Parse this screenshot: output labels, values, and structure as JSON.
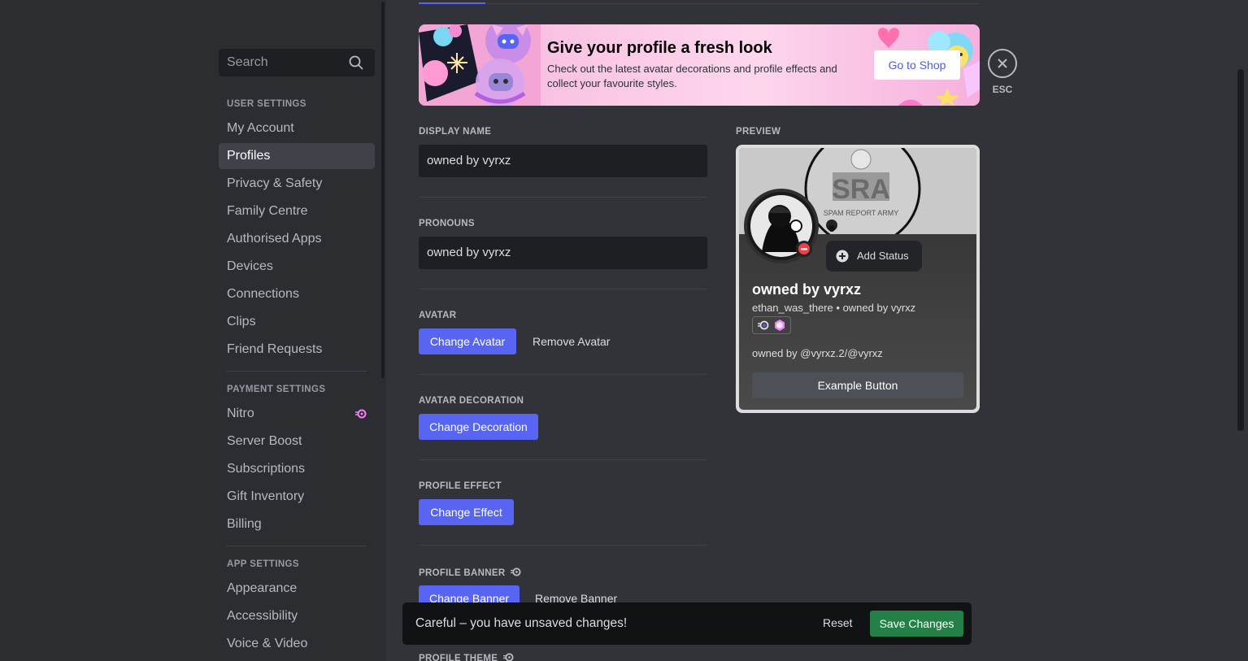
{
  "sidebar": {
    "search_placeholder": "Search",
    "user_settings_header": "USER SETTINGS",
    "user_items": [
      "My Account",
      "Profiles",
      "Privacy & Safety",
      "Family Centre",
      "Authorised Apps",
      "Devices",
      "Connections",
      "Clips",
      "Friend Requests"
    ],
    "payment_settings_header": "PAYMENT SETTINGS",
    "payment_items": [
      "Nitro",
      "Server Boost",
      "Subscriptions",
      "Gift Inventory",
      "Billing"
    ],
    "app_settings_header": "APP SETTINGS",
    "app_items": [
      "Appearance",
      "Accessibility",
      "Voice & Video"
    ],
    "active_item": "Profiles"
  },
  "promo": {
    "title": "Give your profile a fresh look",
    "description": "Check out the latest avatar decorations and profile effects and collect your favourite styles.",
    "button": "Go to Shop"
  },
  "close": {
    "label": "ESC"
  },
  "form": {
    "display_name_label": "DISPLAY NAME",
    "display_name_value": "owned by vyrxz",
    "pronouns_label": "PRONOUNS",
    "pronouns_value": "owned by vyrxz",
    "avatar_label": "AVATAR",
    "change_avatar": "Change Avatar",
    "remove_avatar": "Remove Avatar",
    "decoration_label": "AVATAR DECORATION",
    "change_decoration": "Change Decoration",
    "effect_label": "PROFILE EFFECT",
    "change_effect": "Change Effect",
    "banner_label": "PROFILE BANNER",
    "change_banner": "Change Banner",
    "remove_banner": "Remove Banner",
    "theme_label": "PROFILE THEME"
  },
  "preview": {
    "label": "PREVIEW",
    "add_status": "Add Status",
    "display_name": "owned by vyrxz",
    "username": "ethan_was_there",
    "pronouns": "owned by vyrxz",
    "separator": "•",
    "bio": "owned by @vyrxz.2/@vyrxz",
    "example_button": "Example Button",
    "banner_text": "SRA",
    "banner_subtext": "SPAM REPORT ARMY"
  },
  "unsaved": {
    "message": "Careful – you have unsaved changes!",
    "reset": "Reset",
    "save": "Save Changes"
  },
  "colors": {
    "accent": "#5865f2",
    "save": "#248046",
    "nitro": "#f47fff",
    "dnd": "#f23f43"
  }
}
